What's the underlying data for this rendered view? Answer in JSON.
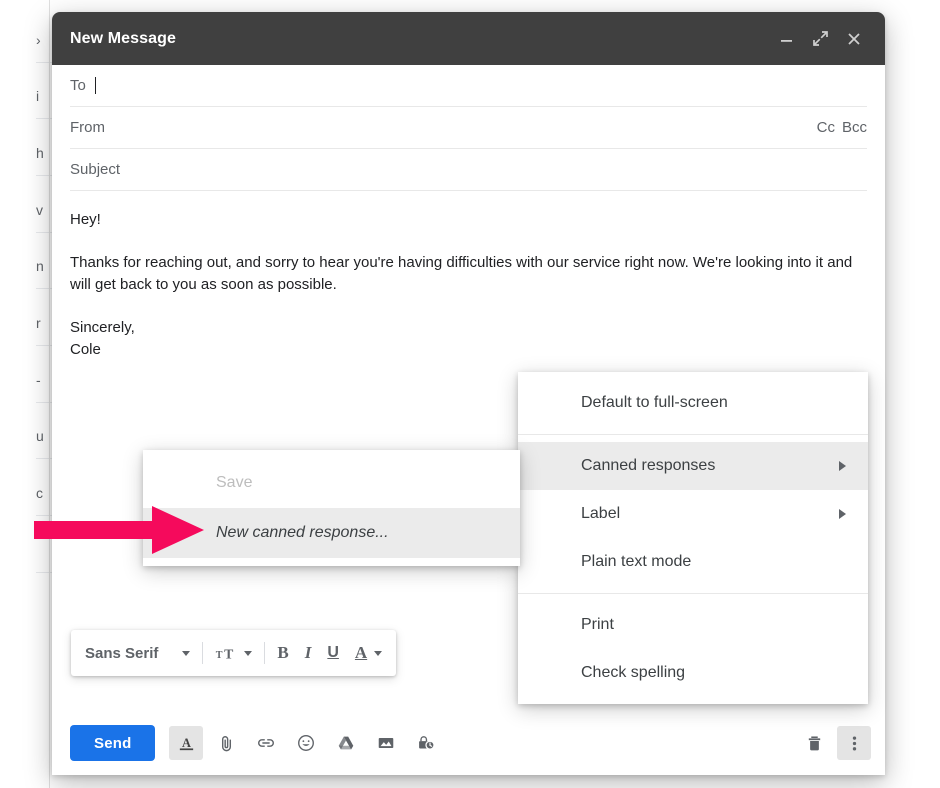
{
  "window": {
    "title": "New Message",
    "controls": [
      {
        "name": "minimize",
        "label": "–"
      },
      {
        "name": "fullscreen",
        "label": "↗"
      },
      {
        "name": "close",
        "label": "✕"
      }
    ]
  },
  "fields": {
    "to_label": "To",
    "to_value": "",
    "from_label": "From",
    "from_value": "",
    "cc_label": "Cc",
    "bcc_label": "Bcc",
    "subject_label": "Subject",
    "subject_value": ""
  },
  "body": {
    "greeting": "Hey!",
    "paragraph": "Thanks for reaching out, and sorry to hear you're having difficulties with our service right now. We're looking into it and will get back to you as soon as possible.",
    "signoff": "Sincerely,",
    "signature": "Cole"
  },
  "format_toolbar": {
    "font_family": "Sans Serif",
    "size_icon": "text-size-icon",
    "bold": "B",
    "italic": "I",
    "underline": "U",
    "text_color": "A"
  },
  "send_bar": {
    "send_label": "Send",
    "icons": [
      {
        "name": "formatting-options-icon",
        "label": "A"
      },
      {
        "name": "attach-file-icon",
        "label": "paperclip"
      },
      {
        "name": "insert-link-icon",
        "label": "link"
      },
      {
        "name": "insert-emoji-icon",
        "label": "emoji"
      },
      {
        "name": "insert-drive-icon",
        "label": "google-drive"
      },
      {
        "name": "insert-photo-icon",
        "label": "image"
      },
      {
        "name": "confidential-mode-icon",
        "label": "lock-clock"
      }
    ],
    "discard_icon": "trash-icon",
    "more_options_icon": "more-options-icon"
  },
  "main_menu": {
    "items": [
      {
        "label": "Default to full-screen",
        "submenu": false,
        "highlight": false,
        "disabled": false
      },
      {
        "separator": true
      },
      {
        "label": "Canned responses",
        "submenu": true,
        "highlight": true,
        "disabled": false
      },
      {
        "label": "Label",
        "submenu": true,
        "highlight": false,
        "disabled": false
      },
      {
        "label": "Plain text mode",
        "submenu": false,
        "highlight": false,
        "disabled": false
      },
      {
        "separator": true
      },
      {
        "label": "Print",
        "submenu": false,
        "highlight": false,
        "disabled": false
      },
      {
        "label": "Check spelling",
        "submenu": false,
        "highlight": false,
        "disabled": false
      }
    ]
  },
  "canned_submenu": {
    "items": [
      {
        "label": "Save",
        "disabled": true,
        "italic": false,
        "highlight": false
      },
      {
        "label": "New canned response...",
        "disabled": false,
        "italic": true,
        "highlight": true
      }
    ]
  },
  "annotation": {
    "arrow_color": "#f50a5c",
    "points_to": "New canned response..."
  },
  "background": {
    "fragments": [
      "›",
      "i",
      "h",
      "v",
      "n",
      "r",
      "-",
      "u",
      "c"
    ]
  },
  "colors": {
    "titlebar": "#404040",
    "send_button": "#1a73e8",
    "menu_highlight": "#ebebeb",
    "arrow": "#f50a5c"
  }
}
